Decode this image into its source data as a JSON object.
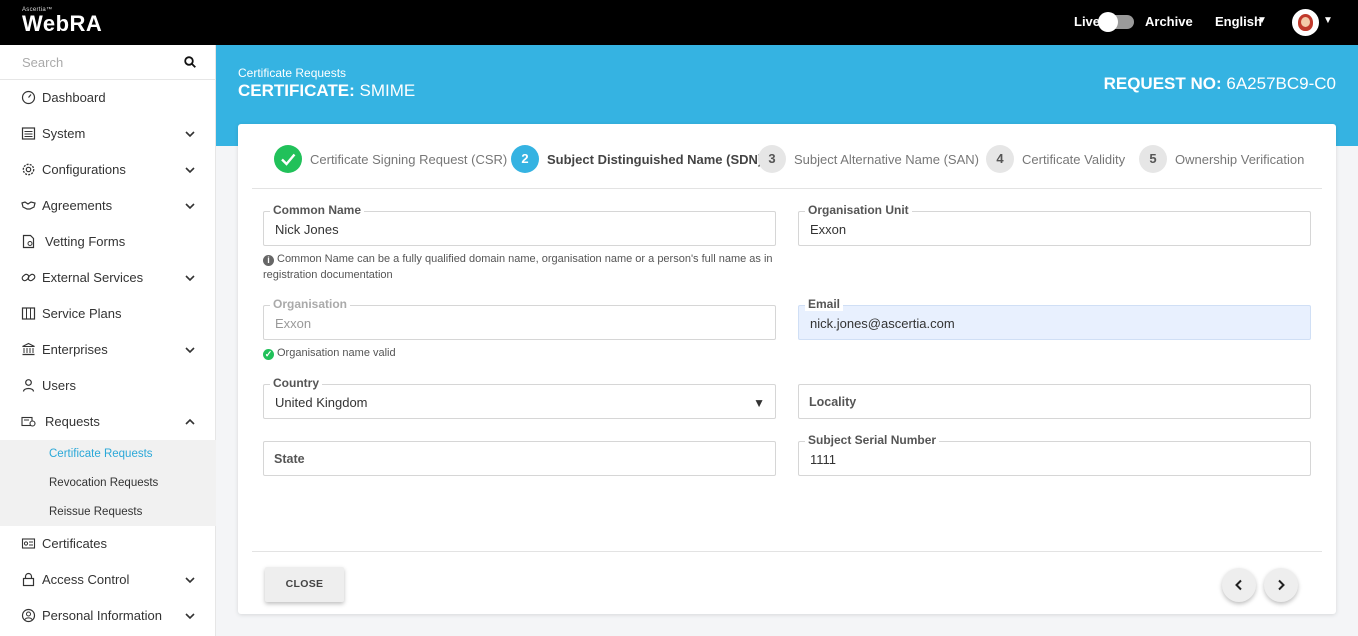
{
  "topbar": {
    "brand_small": "Ascertia™",
    "brand": "WebRA",
    "live_label": "Live",
    "archive_label": "Archive",
    "language": "English"
  },
  "sidebar": {
    "search_placeholder": "Search",
    "items": [
      {
        "label": "Dashboard",
        "icon": "dashboard-icon"
      },
      {
        "label": "System",
        "icon": "system-icon"
      },
      {
        "label": "Configurations",
        "icon": "gear-icon"
      },
      {
        "label": "Agreements",
        "icon": "handshake-icon"
      },
      {
        "label": "Vetting Forms",
        "icon": "form-icon"
      },
      {
        "label": "External Services",
        "icon": "link-icon"
      },
      {
        "label": "Service Plans",
        "icon": "plans-icon"
      },
      {
        "label": "Enterprises",
        "icon": "bank-icon"
      },
      {
        "label": "Users",
        "icon": "user-icon"
      },
      {
        "label": "Requests",
        "icon": "requests-icon"
      },
      {
        "label": "Certificates",
        "icon": "certificate-icon"
      },
      {
        "label": "Access Control",
        "icon": "lock-icon"
      },
      {
        "label": "Personal Information",
        "icon": "person-icon"
      }
    ],
    "requests_sub": [
      "Certificate Requests",
      "Revocation Requests",
      "Reissue Requests"
    ]
  },
  "banner": {
    "breadcrumb": "Certificate Requests",
    "title_prefix": "CERTIFICATE:",
    "title_value": "SMIME",
    "request_prefix": "REQUEST NO:",
    "request_value": "6A257BC9-C0"
  },
  "stepper": [
    {
      "num": "",
      "label": "Certificate Signing Request (CSR)",
      "state": "done"
    },
    {
      "num": "2",
      "label": "Subject Distinguished Name (SDN)",
      "state": "current"
    },
    {
      "num": "3",
      "label": "Subject Alternative Name (SAN)",
      "state": "pending"
    },
    {
      "num": "4",
      "label": "Certificate Validity",
      "state": "pending"
    },
    {
      "num": "5",
      "label": "Ownership Verification",
      "state": "pending"
    }
  ],
  "form": {
    "common_name": {
      "label": "Common Name",
      "value": "Nick Jones",
      "hint": "Common Name can be a fully qualified domain name, organisation name or a person's full name as in registration documentation"
    },
    "organisation_unit": {
      "label": "Organisation Unit",
      "value": "Exxon"
    },
    "organisation": {
      "label": "Organisation",
      "value": "Exxon",
      "hint": "Organisation name valid"
    },
    "email": {
      "label": "Email",
      "value": "nick.jones@ascertia.com"
    },
    "country": {
      "label": "Country",
      "value": "United Kingdom"
    },
    "locality": {
      "label": "Locality"
    },
    "state": {
      "label": "State"
    },
    "serial": {
      "label": "Subject Serial Number",
      "value": "1111"
    }
  },
  "footer": {
    "close_label": "CLOSE"
  },
  "colors": {
    "accent": "#35b3e2",
    "success": "#21c15a",
    "topbar": "#000000"
  }
}
